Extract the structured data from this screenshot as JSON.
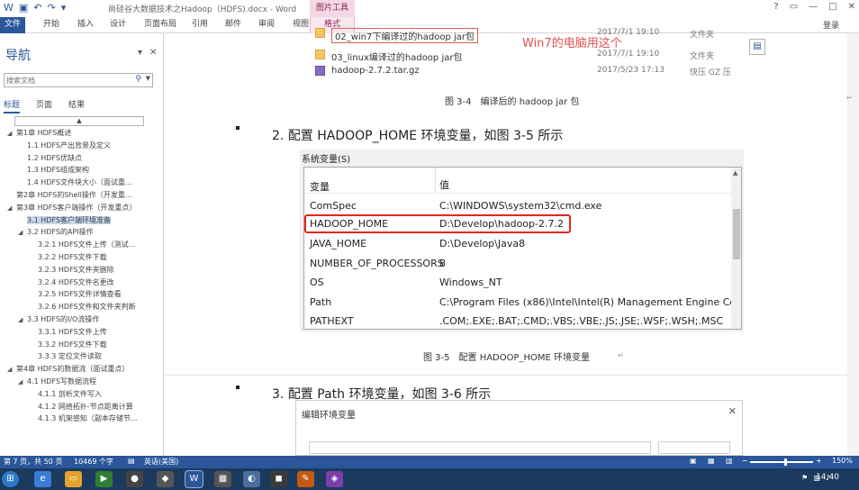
{
  "title_bar": {
    "qat_icons": [
      "word-icon",
      "save-icon",
      "undo-icon",
      "redo-icon",
      "customize-icon"
    ],
    "doc_title": "尚硅谷大数据技术之Hadoop（HDFS).docx - Word",
    "picture_tools": "图片工具"
  },
  "ribbon": {
    "tabs": [
      "文件",
      "开始",
      "插入",
      "设计",
      "页面布局",
      "引用",
      "邮件",
      "审阅",
      "视图",
      "格式"
    ],
    "sign_in": "登录"
  },
  "nav": {
    "title": "导航",
    "search_placeholder": "搜索文档",
    "tabs": [
      "标题",
      "页面",
      "结果"
    ],
    "items": [
      {
        "label": "第1章 HDFS概述",
        "level": 1,
        "expanded": true
      },
      {
        "label": "1.1 HDFS产出背景及定义",
        "level": 2
      },
      {
        "label": "1.2 HDFS优缺点",
        "level": 2
      },
      {
        "label": "1.3 HDFS组成架构",
        "level": 2
      },
      {
        "label": "1.4 HDFS文件块大小（面试重...",
        "level": 2
      },
      {
        "label": "第2章 HDFS的Shell操作（开发重...",
        "level": 1
      },
      {
        "label": "第3章 HDFS客户端操作（开发重点）",
        "level": 1,
        "expanded": true
      },
      {
        "label": "3.1 HDFS客户端环境准备",
        "level": 2,
        "selected": true
      },
      {
        "label": "3.2 HDFS的API操作",
        "level": 2,
        "expanded": true
      },
      {
        "label": "3.2.1 HDFS文件上传（测试...",
        "level": 3
      },
      {
        "label": "3.2.2 HDFS文件下载",
        "level": 3
      },
      {
        "label": "3.2.3 HDFS文件夹删除",
        "level": 3
      },
      {
        "label": "3.2.4 HDFS文件名更改",
        "level": 3
      },
      {
        "label": "3.2.5 HDFS文件详情查看",
        "level": 3
      },
      {
        "label": "3.2.6 HDFS文件和文件夹判断",
        "level": 3
      },
      {
        "label": "3.3 HDFS的I/O流操作",
        "level": 2,
        "expanded": true
      },
      {
        "label": "3.3.1 HDFS文件上传",
        "level": 3
      },
      {
        "label": "3.3.2 HDFS文件下载",
        "level": 3
      },
      {
        "label": "3.3.3 定位文件读取",
        "level": 3
      },
      {
        "label": "第4章 HDFS的数据流（面试重点）",
        "level": 1,
        "expanded": true
      },
      {
        "label": "4.1 HDFS写数据流程",
        "level": 2,
        "expanded": true
      },
      {
        "label": "4.1.1 剖析文件写入",
        "level": 3
      },
      {
        "label": "4.1.2 网络拓扑-节点距离计算",
        "level": 3
      },
      {
        "label": "4.1.3 机架感知（副本存储节...",
        "level": 3
      }
    ]
  },
  "doc": {
    "explorer_files": [
      {
        "name": "02_win7下编译过的hadoop jar包",
        "date": "2017/7/1 19:10",
        "type": "文件夹"
      },
      {
        "name": "03_linux编译过的hadoop jar包",
        "date": "2017/7/1 19:10",
        "type": "文件夹"
      },
      {
        "name": "hadoop-2.7.2.tar.gz",
        "date": "2017/5/23 17:13",
        "type": "快压 GZ 压"
      }
    ],
    "explorer_annotation": "Win7的电脑用这个",
    "caption_34": "图 3-4　编译后的 hadoop jar 包",
    "heading2": "2.  配置 HADOOP_HOME 环境变量，如图 3-5 所示",
    "sysvars_label": "系统变量(S)",
    "col_var": "变量",
    "col_val": "值",
    "sysvars": [
      {
        "name": "ComSpec",
        "value": "C:\\WINDOWS\\system32\\cmd.exe"
      },
      {
        "name": "HADOOP_HOME",
        "value": "D:\\Develop\\hadoop-2.7.2"
      },
      {
        "name": "JAVA_HOME",
        "value": "D:\\Develop\\Java8"
      },
      {
        "name": "NUMBER_OF_PROCESSORS",
        "value": "8"
      },
      {
        "name": "OS",
        "value": "Windows_NT"
      },
      {
        "name": "Path",
        "value": "C:\\Program Files (x86)\\Intel\\Intel(R) Management Engine Co..."
      },
      {
        "name": "PATHEXT",
        "value": ".COM;.EXE;.BAT;.CMD;.VBS;.VBE;.JS;.JSE;.WSF;.WSH;.MSC"
      }
    ],
    "caption_35": "图 3-5　配置 HADOOP_HOME 环境变量",
    "heading3": "3.  配置 Path 环境变量，如图 3-6 所示",
    "env_dialog_title": "编辑环境变量"
  },
  "status": {
    "page": "第 7 页，共 50 页",
    "words": "10469 个字",
    "lang": "英语(美国)",
    "zoom": "150%",
    "zoom_value": 150
  },
  "taskbar": {
    "icons": [
      "start-icon",
      "ie-icon",
      "explorer-icon",
      "media-icon",
      "app-icon",
      "app2-icon",
      "word-taskbar-icon",
      "app3-icon",
      "app4-icon",
      "app5-icon",
      "app6-icon",
      "app7-icon"
    ],
    "clock": "14:40"
  },
  "colors": {
    "word_blue": "#2b579a",
    "highlight_red": "#e0281e",
    "picture_tools_pink": "#f4d7e3",
    "taskbar": "#1c3a5e"
  }
}
